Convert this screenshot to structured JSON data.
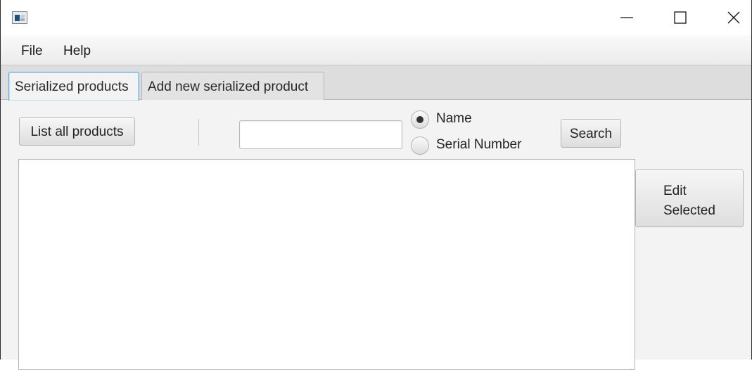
{
  "titlebar": {
    "title": "",
    "icons": [
      "app-icon",
      "minimize-icon",
      "maximize-icon",
      "close-icon"
    ]
  },
  "menu": {
    "items": [
      {
        "label": "File"
      },
      {
        "label": "Help"
      }
    ]
  },
  "tabs": [
    {
      "label": "Serialized products",
      "selected": true
    },
    {
      "label": "Add new serialized product",
      "selected": false
    }
  ],
  "toolbar": {
    "list_all_label": "List all products",
    "search_input": {
      "value": "",
      "placeholder": ""
    },
    "search_by": [
      {
        "label": "Name",
        "selected": true
      },
      {
        "label": "Serial Number",
        "selected": false
      }
    ],
    "search_label": "Search"
  },
  "side": {
    "edit_label": "Edit\nSelected"
  },
  "list": {
    "items": []
  },
  "colors": {
    "active_tab_border": "#5aa8dc",
    "window_bg": "#f3f3f3",
    "tab_header_bg": "#dddddd"
  }
}
